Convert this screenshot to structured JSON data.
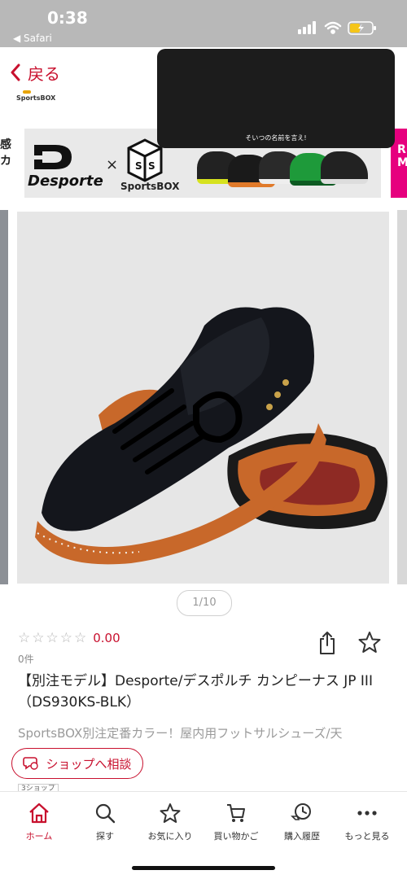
{
  "status_bar": {
    "time": "0:38",
    "back_app": "◀ Safari"
  },
  "header": {
    "back_label": "戻る",
    "shop_logo": "SportsBOX"
  },
  "tooltip": {
    "text": "そいつの名前を言え!"
  },
  "banner": {
    "brand": "Desporte",
    "cross": "×",
    "partner": "SportsBOX",
    "left_edge_text": "感\nカ",
    "right_edge_text": "R\nM"
  },
  "gallery": {
    "pager": "1/10"
  },
  "product": {
    "rating_score": "0.00",
    "review_count": "0件",
    "title": "【別注モデル】Desporte/デスポルチ カンピーナス JP III（DS930KS-BLK）",
    "subtitle": "SportsBOX別注定番カラー！屋内用フットサルシューズ/天",
    "badge": "3ショップ"
  },
  "consult_button": {
    "label": "ショップへ相談"
  },
  "tabbar": {
    "items": [
      {
        "label": "ホーム",
        "icon": "home-icon",
        "active": true
      },
      {
        "label": "探す",
        "icon": "search-icon",
        "active": false
      },
      {
        "label": "お気に入り",
        "icon": "star-icon",
        "active": false
      },
      {
        "label": "買い物かご",
        "icon": "cart-icon",
        "active": false
      },
      {
        "label": "購入履歴",
        "icon": "history-icon",
        "active": false
      },
      {
        "label": "もっと見る",
        "icon": "more-icon",
        "active": false
      }
    ]
  },
  "colors": {
    "accent": "#c8102e",
    "banner_pink": "#e6007e",
    "status_bar": "#b8b8b8"
  }
}
